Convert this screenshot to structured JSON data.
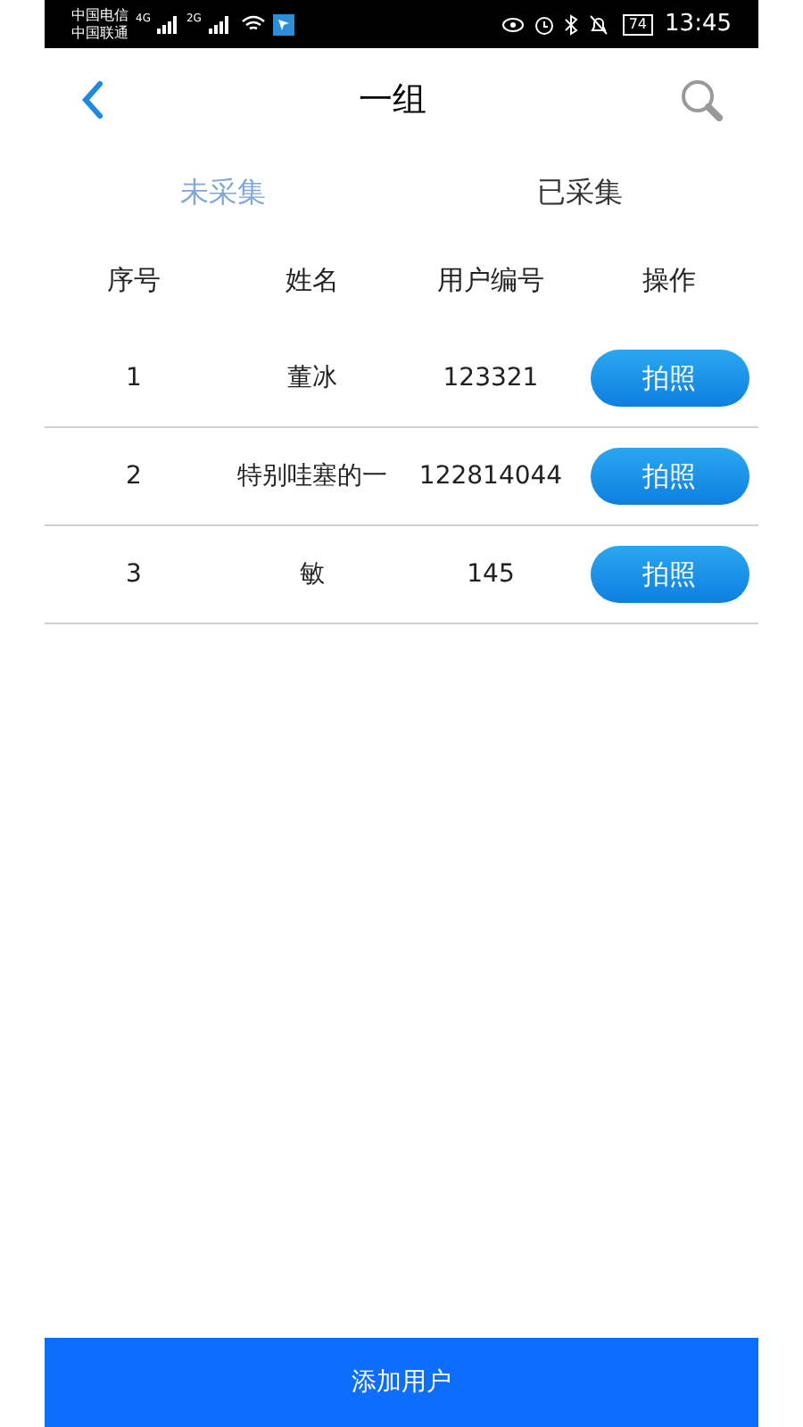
{
  "status_bar": {
    "carriers": [
      "中国电信",
      "中国联通"
    ],
    "networks": [
      "4G",
      "2G"
    ],
    "battery": "74",
    "time": "13:45"
  },
  "header": {
    "title": "一组"
  },
  "tabs": [
    {
      "label": "未采集",
      "selected": true
    },
    {
      "label": "已采集",
      "selected": false
    }
  ],
  "table": {
    "columns": [
      "序号",
      "姓名",
      "用户编号",
      "操作"
    ],
    "rows": [
      {
        "index": "1",
        "name": "董冰",
        "user_id": "123321",
        "action": "拍照"
      },
      {
        "index": "2",
        "name": "特别哇塞的一",
        "user_id": "122814044",
        "action": "拍照"
      },
      {
        "index": "3",
        "name": "敏",
        "user_id": "145",
        "action": "拍照"
      }
    ]
  },
  "footer_button": "添加用户"
}
